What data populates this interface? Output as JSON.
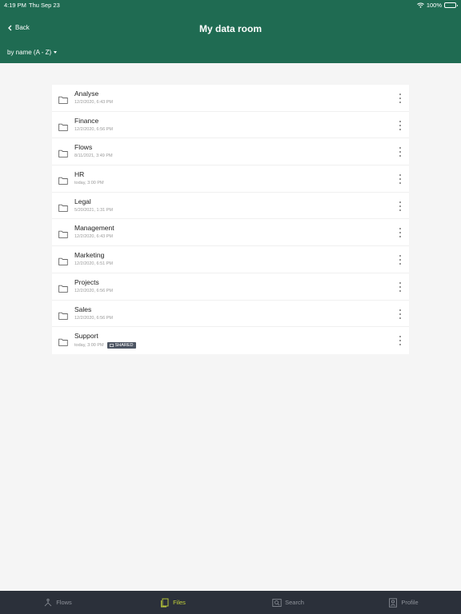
{
  "status": {
    "time": "4:19 PM",
    "date": "Thu Sep 23",
    "battery": "100%"
  },
  "header": {
    "back_label": "Back",
    "title": "My data room",
    "sort_label": "by name (A - Z)"
  },
  "files": [
    {
      "name": "Analyse",
      "date": "12/2/2020, 6:43 PM"
    },
    {
      "name": "Finance",
      "date": "12/2/2020, 6:56 PM"
    },
    {
      "name": "Flows",
      "date": "8/11/2021, 3:49 PM"
    },
    {
      "name": "HR",
      "date": "today, 3:00 PM"
    },
    {
      "name": "Legal",
      "date": "5/20/2021, 1:31 PM"
    },
    {
      "name": "Management",
      "date": "12/2/2020, 6:43 PM"
    },
    {
      "name": "Marketing",
      "date": "12/2/2020, 6:51 PM"
    },
    {
      "name": "Projects",
      "date": "12/2/2020, 6:56 PM"
    },
    {
      "name": "Sales",
      "date": "12/2/2020, 6:56 PM"
    },
    {
      "name": "Support",
      "date": "today, 3:00 PM",
      "badge": "SHARED"
    }
  ],
  "tabs": [
    {
      "label": "Flows",
      "icon": "flows-icon",
      "active": false
    },
    {
      "label": "Files",
      "icon": "files-icon",
      "active": true
    },
    {
      "label": "Search",
      "icon": "search-icon",
      "active": false
    },
    {
      "label": "Profile",
      "icon": "profile-icon",
      "active": false
    }
  ],
  "colors": {
    "header": "#1f6b52",
    "tabbar": "#2b303a",
    "active_tab": "#c3d23a"
  }
}
